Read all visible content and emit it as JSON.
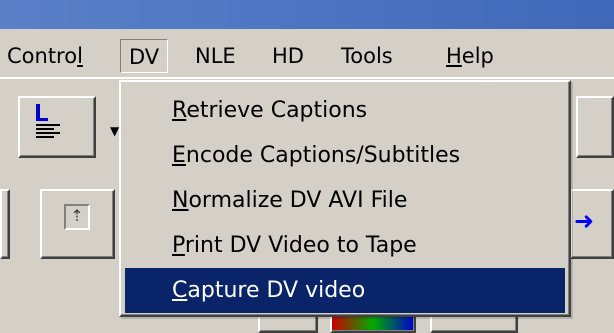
{
  "menubar": {
    "items": [
      {
        "label_pre": "Contro",
        "acc": "l",
        "label_post": ""
      },
      {
        "label_pre": "DV",
        "acc": "",
        "label_post": ""
      },
      {
        "label_pre": "NLE",
        "acc": "",
        "label_post": ""
      },
      {
        "label_pre": "HD",
        "acc": "",
        "label_post": ""
      },
      {
        "label_pre": "Tools",
        "acc": "",
        "label_post": ""
      },
      {
        "label_pre": "",
        "acc": "H",
        "label_post": "elp"
      }
    ]
  },
  "dv_menu": {
    "items": [
      {
        "acc": "R",
        "rest": "etrieve Captions"
      },
      {
        "acc": "E",
        "rest": "ncode Captions/Subtitles"
      },
      {
        "acc": "N",
        "rest": "ormalize DV AVI File"
      },
      {
        "acc": "P",
        "rest": "rint DV Video to Tape"
      },
      {
        "acc": "C",
        "rest": "apture DV video"
      }
    ],
    "selected_index": 4
  },
  "colors": {
    "titlebar": "#4a72c0",
    "face": "#d4d0c8",
    "highlight": "#0a246a",
    "highlight_text": "#ffffff"
  },
  "icons": [
    "align-left-icon",
    "dropdown-arrow-icon",
    "upload-box-icon",
    "arrow-right-icon"
  ]
}
